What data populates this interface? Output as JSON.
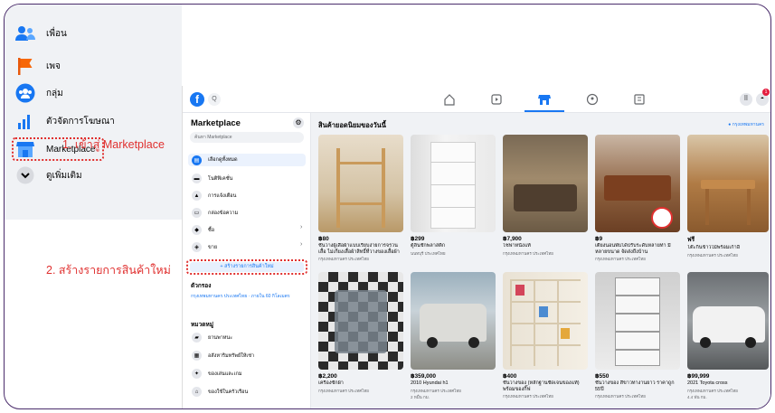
{
  "fb_menu": {
    "items": [
      {
        "label": "เพื่อน",
        "icon": "friends-icon"
      },
      {
        "label": "เพจ",
        "icon": "pages-flag-icon"
      },
      {
        "label": "กลุ่ม",
        "icon": "groups-icon"
      },
      {
        "label": "ตัวจัดการโฆษณา",
        "icon": "ads-manager-icon"
      },
      {
        "label": "Marketplace",
        "icon": "marketplace-store-icon"
      },
      {
        "label": "ดูเพิ่มเติม",
        "icon": "chevron-down-icon"
      }
    ]
  },
  "annotations": {
    "step1": "1. เข้าสู่ Marketplace",
    "step2": "2. สร้างรายการสินค้าใหม่"
  },
  "topbar": {
    "search_placeholder": "Q",
    "badge": "1"
  },
  "sidebar": {
    "title": "Marketplace",
    "search_placeholder": "ค้นหา Marketplace",
    "items": [
      {
        "label": "เลือกดูทั้งหมด",
        "active": true
      },
      {
        "label": "โนติฟิเคชั่น"
      },
      {
        "label": "การแจ้งเตือน"
      },
      {
        "label": "กล่องข้อความ"
      },
      {
        "label": "ซื้อ"
      },
      {
        "label": "ขาย"
      }
    ],
    "create_label": "+ สร้างรายการสินค้าใหม่",
    "filter_title": "ตัวกรอง",
    "filter_location": "กรุงเทพมหานคร ประเทศไทย · ภายใน 60 กิโลเมตร",
    "category_title": "หมวดหมู่",
    "categories": [
      {
        "label": "ยานพาหนะ"
      },
      {
        "label": "อสังหาริมทรัพย์ให้เช่า"
      },
      {
        "label": "ของเล่นและเกม"
      },
      {
        "label": "ของใช้ในครัวเรือน"
      }
    ]
  },
  "main": {
    "title": "สินค้ายอดนิยมของวันนี้",
    "location": "กรุงเทพมหานคร",
    "listings": [
      {
        "price": "฿80",
        "title": "ชั้นวางผู้เสื้อผ้าแบบเรียบง่ายการจรวนเสื้อ ไม่เกี่ยงเสื้อผ้าสิทธิ์ที่วางของเสื้อผ้า",
        "loc": "กรุงเทพมหานคร ประเทศไทย",
        "extra": ""
      },
      {
        "price": "฿299",
        "title": "ตู้ลิ้นชักพลาสติก",
        "loc": "นนทบุรี ประเทศไทย",
        "extra": ""
      },
      {
        "price": "฿7,900",
        "title": "โซฟาหนังแท้",
        "loc": "กรุงเทพมหานคร ประเทศไทย",
        "extra": ""
      },
      {
        "price": "฿9",
        "title": "เตียงนอนพับได้ปรับระดับหลายท่า มี หลายขนาด จัดส่งถึงบ้าน",
        "loc": "กรุงเทพมหานคร ประเทศไทย",
        "extra": ""
      },
      {
        "price": "ฟรี",
        "title": "โต๊ะกินข้าวไม้พร้อมเก้าอี้",
        "loc": "กรุงเทพมหานคร ประเทศไทย",
        "extra": ""
      },
      {
        "price": "฿2,200",
        "title": "เครื่องซักผ้า",
        "loc": "กรุงเทพมหานคร ประเทศไทย",
        "extra": ""
      },
      {
        "price": "฿359,000",
        "title": "2010 Hyundai h1",
        "loc": "กรุงเทพมหานคร ประเทศไทย",
        "extra": "2 หมื่น กม."
      },
      {
        "price": "฿400",
        "title": "ชั้นวางของ (หลักฐานชัดเจนของแท้) พร้อมของกิ๊ฟ",
        "loc": "กรุงเทพมหานคร ประเทศไทย",
        "extra": ""
      },
      {
        "price": "฿550",
        "title": "ชั้นวางของ สีขาวทางานยาว ราคาถูก 55ปี",
        "loc": "กรุงเทพมหานคร ประเทศไทย",
        "extra": ""
      },
      {
        "price": "฿99,999",
        "title": "2021 Toyota cross",
        "loc": "กรุงเทพมหานคร ประเทศไทย",
        "extra": "4.4 พัน กม."
      }
    ]
  },
  "colors": {
    "accent": "#1877f2",
    "annotation": "#e0302f",
    "border": "#4a2c6b"
  }
}
